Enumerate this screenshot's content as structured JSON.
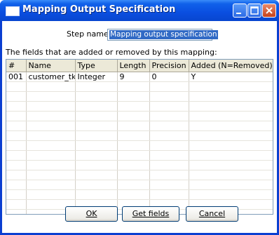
{
  "window": {
    "title": "Mapping Output Specification"
  },
  "step": {
    "label": "Step name",
    "value": "Mapping output specification"
  },
  "fields_label": "The fields that are added or removed by this mapping:",
  "grid": {
    "columns": [
      "#",
      "Name",
      "Type",
      "Length",
      "Precision",
      "Added (N=Removed)"
    ],
    "rows": [
      [
        "001",
        "customer_tk",
        "Integer",
        "9",
        "0",
        "Y"
      ]
    ],
    "empty_rows": 15
  },
  "buttons": {
    "ok": "OK",
    "get_fields": "Get fields",
    "cancel": "Cancel"
  }
}
